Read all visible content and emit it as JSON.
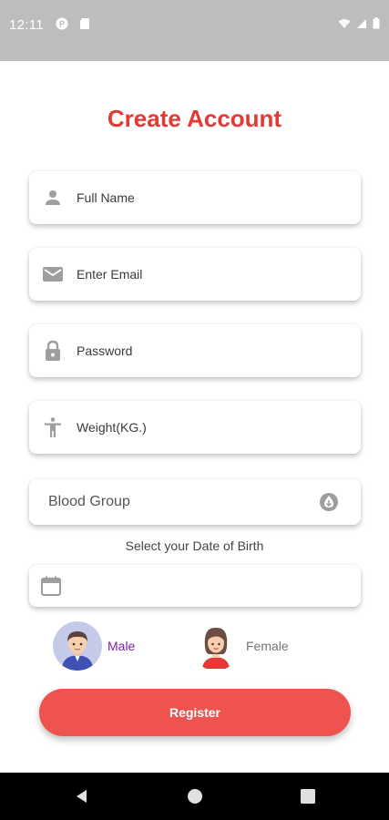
{
  "status_bar": {
    "time": "12:11",
    "icons": [
      "notification-icon",
      "sd-card-icon",
      "wifi-icon",
      "signal-icon",
      "battery-icon"
    ]
  },
  "form": {
    "title": "Create Account",
    "full_name": {
      "placeholder": "Full Name",
      "icon": "person-icon"
    },
    "email": {
      "placeholder": "Enter Email",
      "icon": "email-icon"
    },
    "password": {
      "placeholder": "Password",
      "icon": "lock-icon"
    },
    "weight": {
      "placeholder": "Weight(KG.)",
      "icon": "accessibility-icon"
    },
    "blood_group": {
      "label": "Blood Group",
      "icon": "blood-drop-icon"
    },
    "dob": {
      "label": "Select your Date of Birth",
      "value": "",
      "icon": "calendar-icon"
    },
    "gender": {
      "male_label": "Male",
      "female_label": "Female",
      "selected": "Male"
    },
    "register_label": "Register"
  },
  "colors": {
    "accent": "#e53935",
    "button": "#ef5350",
    "selected_gender": "#7b1fa2",
    "unselected_gender": "#757575",
    "icon_gray": "#9e9e9e",
    "status_bar": "#bdbdbd"
  },
  "nav_bar": {
    "buttons": [
      "back-icon",
      "home-icon",
      "recents-icon"
    ]
  }
}
